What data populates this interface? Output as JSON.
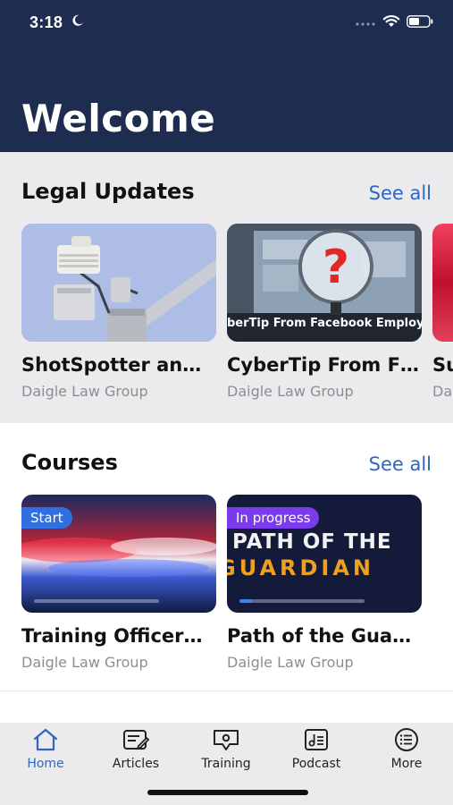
{
  "status": {
    "time": "3:18"
  },
  "header": {
    "title": "Welcome"
  },
  "legal_updates": {
    "title": "Legal Updates",
    "see_all": "See all",
    "items": [
      {
        "title": "ShotSpotter an…",
        "subtitle": "Daigle Law Group"
      },
      {
        "title": "CyberTip From F…",
        "subtitle": "Daigle Law Group",
        "thumb_text": "berTip From Facebook Employ"
      },
      {
        "title": "Su",
        "subtitle": "Da"
      }
    ]
  },
  "courses": {
    "title": "Courses",
    "see_all": "See all",
    "items": [
      {
        "title": "Training Officer…",
        "subtitle": "Daigle Law Group",
        "badge": "Start",
        "badge_color": "#2f6fe0",
        "progress": 0.0
      },
      {
        "title": "Path of the Gua…",
        "subtitle": "Daigle Law Group",
        "badge": "In progress",
        "badge_color": "#7c3aed",
        "progress": 0.1,
        "thumb_line1": "PATH OF THE",
        "thumb_line2": "GUARDIAN"
      }
    ]
  },
  "tabs": [
    {
      "label": "Home",
      "icon": "home-icon",
      "active": true
    },
    {
      "label": "Articles",
      "icon": "articles-icon",
      "active": false
    },
    {
      "label": "Training",
      "icon": "training-icon",
      "active": false
    },
    {
      "label": "Podcast",
      "icon": "podcast-icon",
      "active": false
    },
    {
      "label": "More",
      "icon": "more-icon",
      "active": false
    }
  ],
  "colors": {
    "header": "#1d2c4f",
    "accent": "#2f66c3",
    "section_bg": "#ebebed"
  }
}
